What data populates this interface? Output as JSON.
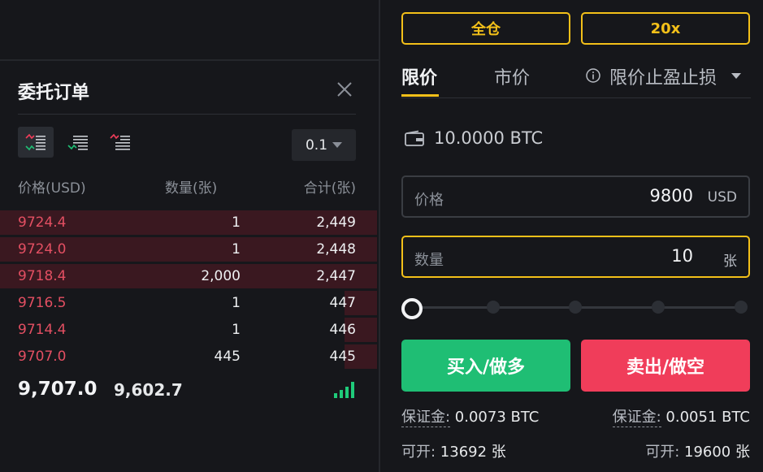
{
  "margin_modes": {
    "cross_label": "全仓",
    "leverage_label": "20x"
  },
  "order_tabs": {
    "limit": "限价",
    "market": "市价",
    "tp_sl": "限价止盈止损"
  },
  "balance": {
    "icon": "wallet-icon",
    "value": "10.0000 BTC"
  },
  "price_field": {
    "label": "价格",
    "value": "9800",
    "unit": "USD"
  },
  "quantity_field": {
    "label": "数量",
    "value": "10",
    "unit": "张"
  },
  "slider": {
    "value": 0,
    "marks": 5
  },
  "buttons": {
    "buy": "买入/做多",
    "sell": "卖出/做空"
  },
  "margin_info": {
    "buy": {
      "label": "保证金:",
      "value": " 0.0073 BTC"
    },
    "sell": {
      "label": "保证金:",
      "value": " 0.0051 BTC"
    }
  },
  "available": {
    "buy": {
      "label": "可开:",
      "value": " 13692 张"
    },
    "sell": {
      "label": "可开:",
      "value": " 19600 张"
    }
  },
  "orderbook": {
    "title": "委托订单",
    "precision": "0.1",
    "columns": {
      "price": "价格(USD)",
      "qty": "数量(张)",
      "total": "合计(张)"
    },
    "asks": [
      {
        "price": "9724.4",
        "qty": "1",
        "total": "2,449",
        "depth": 1.0
      },
      {
        "price": "9724.0",
        "qty": "1",
        "total": "2,448",
        "depth": 1.0
      },
      {
        "price": "9718.4",
        "qty": "2,000",
        "total": "2,447",
        "depth": 1.0
      },
      {
        "price": "9716.5",
        "qty": "1",
        "total": "447",
        "depth": 0.18
      },
      {
        "price": "9714.4",
        "qty": "1",
        "total": "446",
        "depth": 0.18
      },
      {
        "price": "9707.0",
        "qty": "445",
        "total": "445",
        "depth": 0.18
      }
    ],
    "last_price": "9,707.0",
    "mark_price": "9,602.7"
  },
  "colors": {
    "accent": "#f3c019",
    "buy": "#1fbe74",
    "sell": "#f03d5a",
    "ask_text": "#e34f62"
  }
}
